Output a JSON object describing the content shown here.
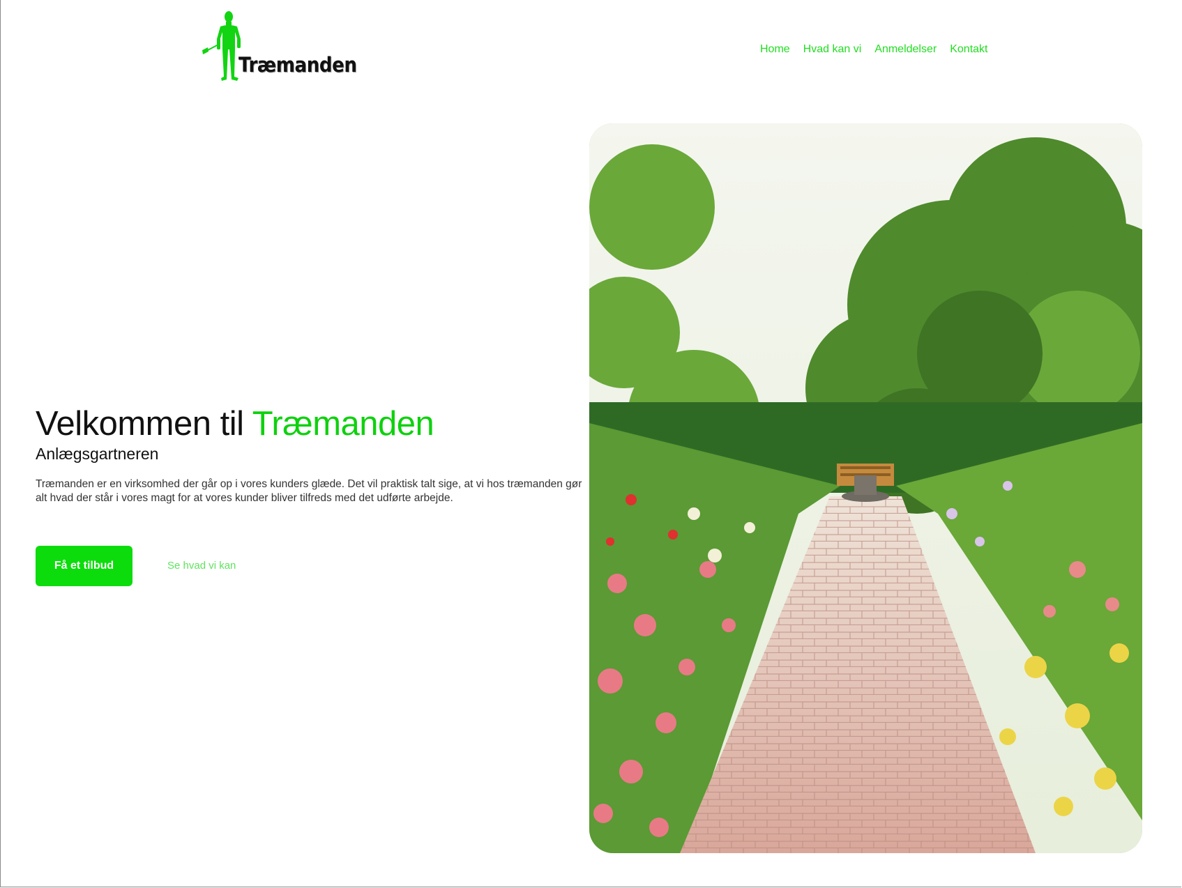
{
  "brand": {
    "name": "Træmanden",
    "logo_icon": "gardener-figure-logo",
    "accent_color": "#0ed10e"
  },
  "nav": {
    "items": [
      {
        "label": "Home"
      },
      {
        "label": "Hvad kan vi"
      },
      {
        "label": "Anmeldelser"
      },
      {
        "label": "Kontakt"
      }
    ]
  },
  "hero": {
    "title_prefix": "Velkommen til ",
    "title_accent": "Træmanden",
    "subtitle": "Anlægsgartneren",
    "body": "Træmanden er en virksomhed der går op i vores kunders glæde. Det vil praktisk talt sige, at vi hos træmanden gør alt hvad der står i vores magt for at vores kunder bliver tilfreds med det udførte arbejde.",
    "cta_label": "Få et tilbud",
    "secondary_label": "Se hvad vi kan",
    "image_subject": "garden-path-photo"
  }
}
